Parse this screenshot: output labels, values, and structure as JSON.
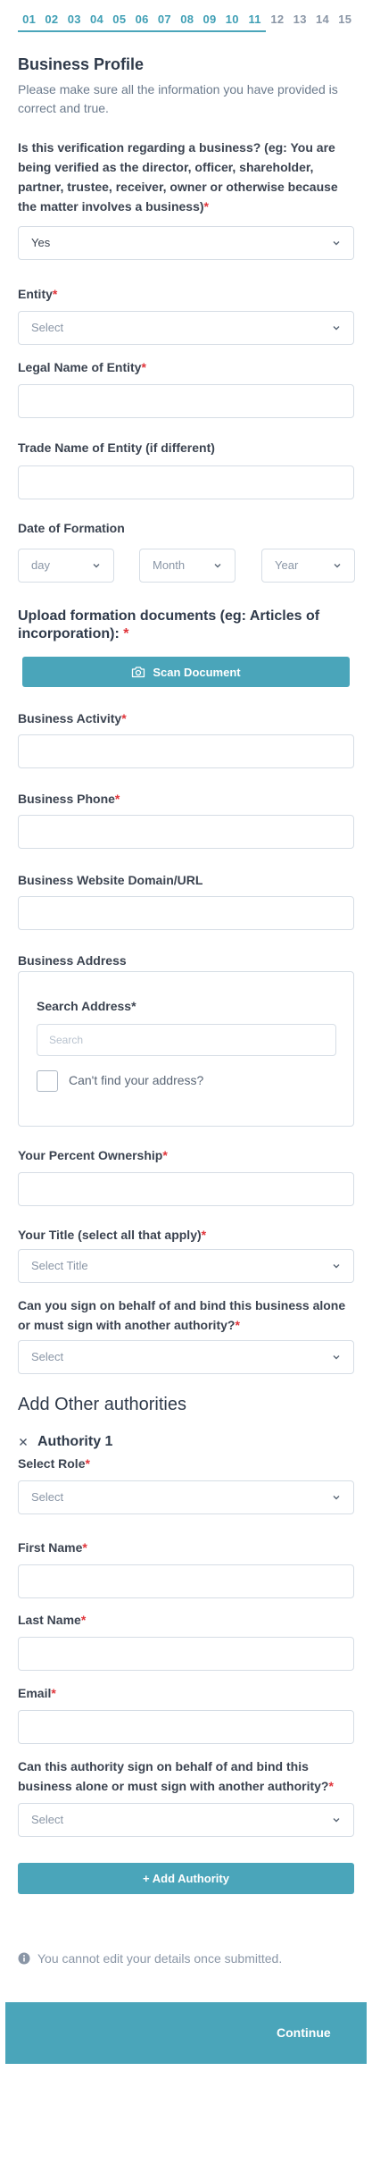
{
  "steps": [
    "01",
    "02",
    "03",
    "04",
    "05",
    "06",
    "07",
    "08",
    "09",
    "10",
    "11",
    "12",
    "13",
    "14",
    "15"
  ],
  "active_steps": 11,
  "colors": {
    "accent": "#4aa5ba",
    "required": "#e0343a",
    "border": "#d6dde5"
  },
  "header": {
    "title": "Business Profile",
    "subtitle": "Please make sure all the information you have provided is correct and true."
  },
  "verification": {
    "question": "Is this verification regarding a business? (eg: You are being verified as the director, officer, shareholder, partner, trustee, receiver, owner or otherwise because the matter involves a business)",
    "value": "Yes"
  },
  "entity": {
    "label": "Entity",
    "placeholder": "Select"
  },
  "legal_name": {
    "label": "Legal Name of Entity"
  },
  "trade_name": {
    "label": "Trade Name of Entity (if different)"
  },
  "date_formation": {
    "label": "Date of Formation",
    "day": "day",
    "month": "Month",
    "year": "Year"
  },
  "upload": {
    "label": "Upload formation documents (eg: Articles of incorporation):",
    "button": "Scan Document"
  },
  "business_activity": {
    "label": "Business Activity"
  },
  "business_phone": {
    "label": "Business Phone"
  },
  "website": {
    "label": "Business Website Domain/URL"
  },
  "address": {
    "label": "Business Address",
    "search_label": "Search Address*",
    "search_placeholder": "Search",
    "cant_find": "Can't find your address?"
  },
  "ownership": {
    "label": "Your Percent Ownership"
  },
  "your_title": {
    "label": "Your Title (select all that apply)",
    "placeholder": "Select Title"
  },
  "sign_authority": {
    "label": "Can you sign on behalf of and bind this business alone or must sign with another authority?",
    "placeholder": "Select"
  },
  "other_authorities": {
    "heading": "Add Other authorities",
    "authority_title": "Authority 1",
    "role_label": "Select Role",
    "role_placeholder": "Select",
    "first_name_label": "First Name",
    "last_name_label": "Last Name",
    "email_label": "Email",
    "sign_label": "Can this authority sign on behalf of and bind this business alone or must sign with another authority?",
    "sign_placeholder": "Select",
    "add_button": "+ Add Authority"
  },
  "notice": "You cannot edit your details once submitted.",
  "continue_button": "Continue",
  "required_mark": "*"
}
